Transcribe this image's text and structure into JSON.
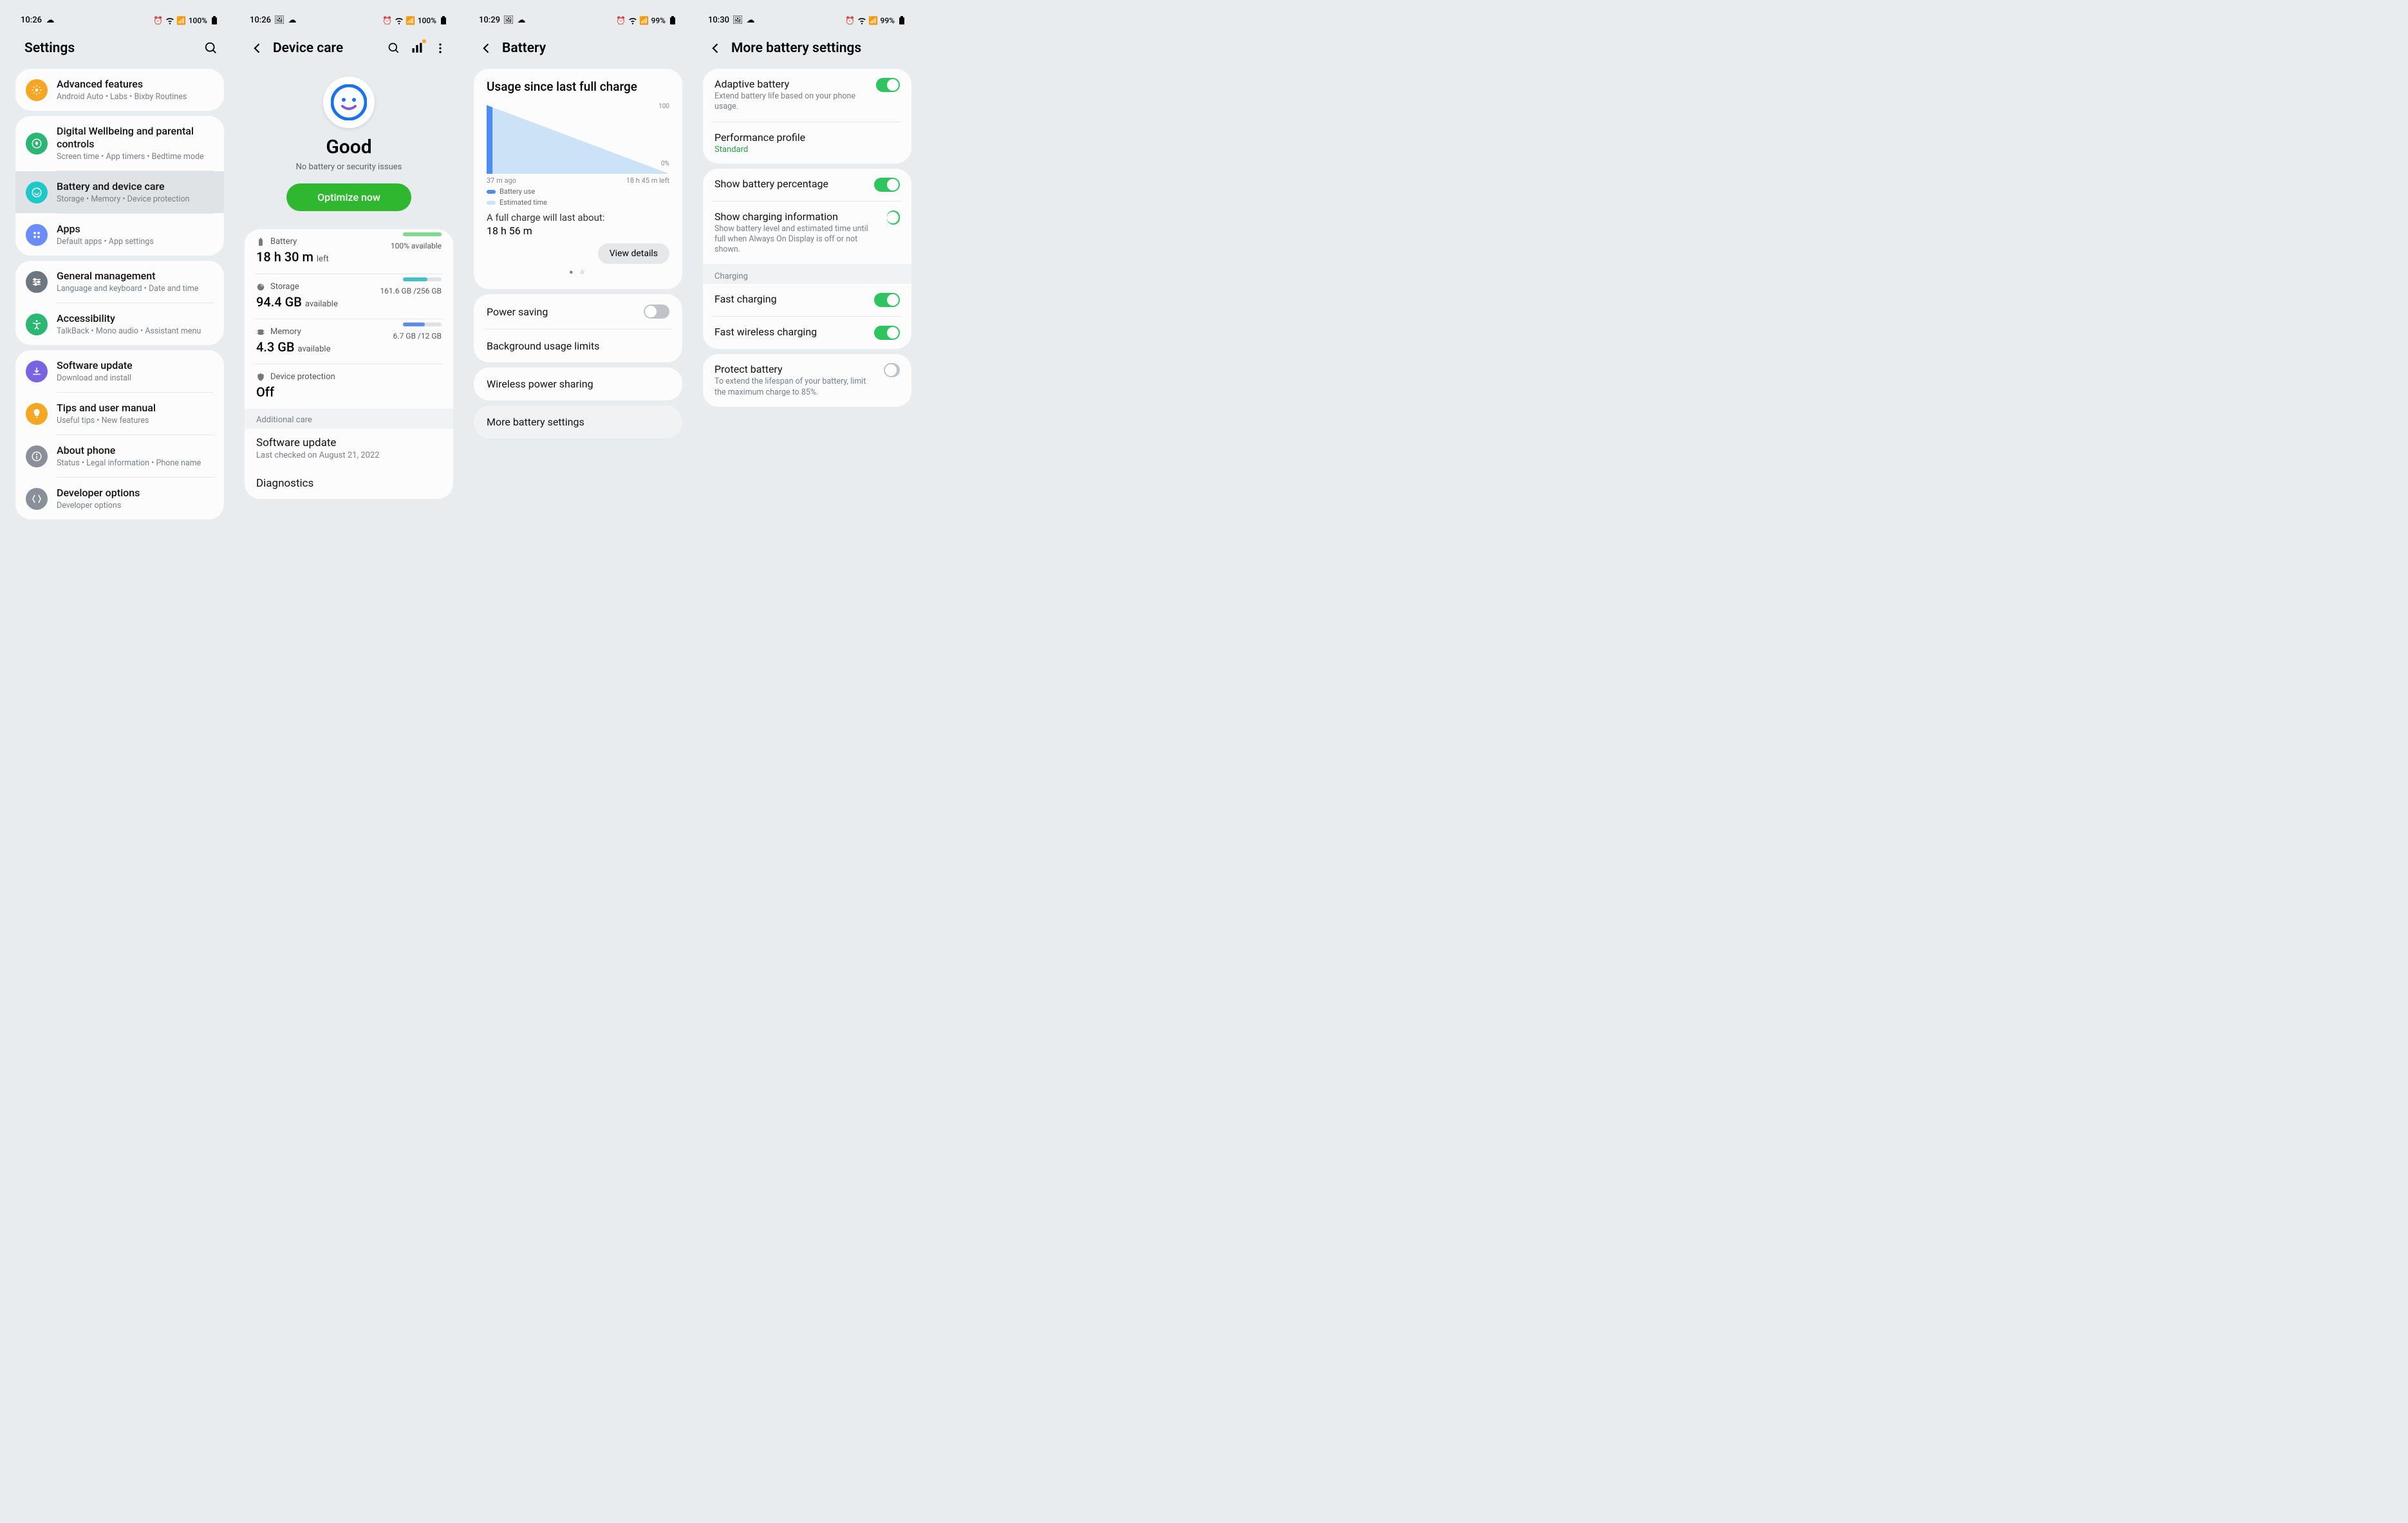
{
  "screens": [
    {
      "statusbar": {
        "time": "10:26",
        "battery": "100%"
      },
      "header": {
        "title": "Settings"
      },
      "groups": [
        {
          "items": [
            {
              "icon": "advanced",
              "color": "#f5a623",
              "title": "Advanced features",
              "sub": "Android Auto  •  Labs  •  Bixby Routines"
            }
          ]
        },
        {
          "items": [
            {
              "icon": "wellbeing",
              "color": "#2bb673",
              "title": "Digital Wellbeing and parental controls",
              "sub": "Screen time  •  App timers  •  Bedtime mode"
            },
            {
              "icon": "care",
              "color": "#1ec8c8",
              "title": "Battery and device care",
              "sub": "Storage  •  Memory  •  Device protection",
              "selected": true
            },
            {
              "icon": "apps",
              "color": "#6a8cff",
              "title": "Apps",
              "sub": "Default apps  •  App settings"
            }
          ]
        },
        {
          "items": [
            {
              "icon": "general",
              "color": "#6e7680",
              "title": "General management",
              "sub": "Language and keyboard  •  Date and time"
            },
            {
              "icon": "a11y",
              "color": "#2bb673",
              "title": "Accessibility",
              "sub": "TalkBack  •  Mono audio  •  Assistant menu"
            }
          ]
        },
        {
          "items": [
            {
              "icon": "update",
              "color": "#7a63e0",
              "title": "Software update",
              "sub": "Download and install"
            },
            {
              "icon": "tips",
              "color": "#f5a623",
              "title": "Tips and user manual",
              "sub": "Useful tips  •  New features"
            },
            {
              "icon": "about",
              "color": "#8a9099",
              "title": "About phone",
              "sub": "Status  •  Legal information  •  Phone name"
            },
            {
              "icon": "dev",
              "color": "#8a9099",
              "title": "Developer options",
              "sub": "Developer options"
            }
          ]
        }
      ]
    },
    {
      "statusbar": {
        "time": "10:26",
        "battery": "100%"
      },
      "header": {
        "title": "Device care"
      },
      "hero": {
        "status": "Good",
        "note": "No battery or security issues",
        "button": "Optimize now"
      },
      "sections": [
        {
          "icon": "battery",
          "label": "Battery",
          "value": "18 h 30 m",
          "suffix": "left",
          "right": "100% available",
          "barColor": "#7ddb8f",
          "barPct": 100
        },
        {
          "icon": "storage",
          "label": "Storage",
          "value": "94.4 GB",
          "suffix": "available",
          "right": "161.6 GB /256 GB",
          "barColor": "#3fc1c9",
          "barPct": 63
        },
        {
          "icon": "memory",
          "label": "Memory",
          "value": "4.3 GB",
          "suffix": "available",
          "right": "6.7 GB /12 GB",
          "barColor": "#5b8def",
          "barPct": 56
        },
        {
          "icon": "shield",
          "label": "Device protection",
          "value": "Off"
        }
      ],
      "additional_label": "Additional care",
      "additional": [
        {
          "title": "Software update",
          "sub": "Last checked on August 21, 2022"
        },
        {
          "title": "Diagnostics"
        }
      ]
    },
    {
      "statusbar": {
        "time": "10:29",
        "battery": "99%"
      },
      "header": {
        "title": "Battery"
      },
      "usage": {
        "title": "Usage since last full charge",
        "left_label": "37 m ago",
        "right_label": "18 h 45 m left",
        "y_top": "100",
        "y_bot": "0%",
        "legend1": "Battery use",
        "legend2": "Estimated time",
        "full_text": "A full charge will last about:",
        "est": "18 h 56 m",
        "view": "View details"
      },
      "rows1": [
        {
          "title": "Power saving",
          "toggle": "off"
        },
        {
          "title": "Background usage limits"
        }
      ],
      "rows2": [
        {
          "title": "Wireless power sharing"
        }
      ],
      "rows3": [
        {
          "title": "More battery settings"
        }
      ]
    },
    {
      "statusbar": {
        "time": "10:30",
        "battery": "99%"
      },
      "header": {
        "title": "More battery settings"
      },
      "g1": [
        {
          "t": "Adaptive battery",
          "s": "Extend battery life based on your phone usage.",
          "toggle": "on"
        },
        {
          "t": "Performance profile",
          "g": "Standard"
        }
      ],
      "g2": [
        {
          "t": "Show battery percentage",
          "toggle": "on"
        },
        {
          "t": "Show charging information",
          "s": "Show battery level and estimated time until full when Always On Display is off or not shown.",
          "toggle": "on"
        }
      ],
      "charging_label": "Charging",
      "g3": [
        {
          "t": "Fast charging",
          "toggle": "on"
        },
        {
          "t": "Fast wireless charging",
          "toggle": "on"
        }
      ],
      "g4": [
        {
          "t": "Protect battery",
          "s": "To extend the lifespan of your battery, limit the maximum charge to 85%.",
          "toggle": "off"
        }
      ]
    }
  ],
  "chart_data": {
    "type": "area",
    "title": "Usage since last full charge",
    "x_range_labels": [
      "37 m ago",
      "18 h 45 m left"
    ],
    "ylim": [
      0,
      100
    ],
    "series": [
      {
        "name": "Battery use",
        "color": "#4d8bf5",
        "x": [
          0,
          0.032
        ],
        "y": [
          100,
          97
        ]
      },
      {
        "name": "Estimated time",
        "color": "#b8d4f5",
        "x": [
          0.032,
          1.0
        ],
        "y": [
          97,
          0
        ]
      }
    ],
    "full_charge_estimate": "18 h 56 m"
  }
}
